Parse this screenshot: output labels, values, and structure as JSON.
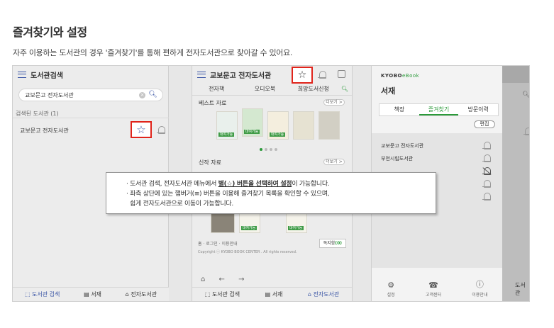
{
  "heading": "즐겨찾기와 설정",
  "description": "자주 이용하는 도서관의 경우 '즐겨찾기'를 통해 편하게 전자도서관으로 찾아갈 수 있어요.",
  "panel1": {
    "header_title": "도서관검색",
    "search_value": "교보문고 전자도서관",
    "section_label": "검색된 도서관 (1)",
    "result_item": "교보문고 전자도서관",
    "star_glyph": "☆",
    "bottom_nav": [
      "도서관 검색",
      "서재",
      "전자도서관"
    ]
  },
  "panel2": {
    "header_title": "교보문고 전자도서관",
    "star_glyph": "☆",
    "tabs": [
      "전자책",
      "오디오북",
      "희망도서신청"
    ],
    "bestseller_label": "베스트 자료",
    "new_label": "신작 자료",
    "more_label": "더보기 >",
    "borrow_label": "대여가능",
    "footer_links": "홈 · 로그인 · 이용안내",
    "copyright": "Copyright ⓒ KYOBO BOOK CENTER . All rights reserved.",
    "popup_label": "독지함",
    "popup_count": "(0)",
    "nav_glyphs": "⌂ ← →",
    "bottom_nav": [
      "도서관 검색",
      "서재",
      "전자도서관"
    ]
  },
  "panel3": {
    "logo_main": "KYOBO",
    "logo_sub": "eBook",
    "title": "서재",
    "tabs": [
      "책장",
      "즐겨찾기",
      "방문이력"
    ],
    "edit_label": "편집",
    "list": [
      "교보문고 전자도서관",
      "부천시립도서관"
    ],
    "bottom_nav": [
      "설정",
      "고객센터",
      "이용안내"
    ]
  },
  "panel4": {
    "bottom_label": "도서관"
  },
  "callout": {
    "line1_prefix": "· 도서관 검색, 전자도서관 메뉴에서 ",
    "line1_strong": "별(☆) 버튼을 선택하여 설정",
    "line1_suffix": "이 가능합니다.",
    "line2": "· 좌측 상단에 있는 햄버거(≡) 버튼을 이용해 즐겨찾기 목록을 확인할 수 있으며,",
    "line3": "쉽게 전자도서관으로 이동이 가능합니다."
  }
}
